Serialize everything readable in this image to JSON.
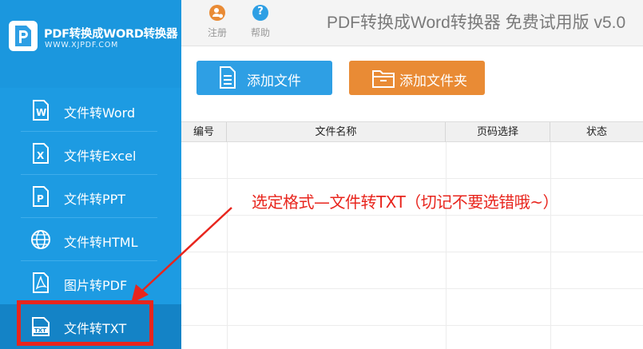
{
  "brand": {
    "title": "PDF转换成WORD转换器",
    "subtitle": "WWW.XJPDF.COM"
  },
  "sidebar": {
    "items": [
      {
        "label": "文件转Word",
        "icon": "word-icon"
      },
      {
        "label": "文件转Excel",
        "icon": "excel-icon"
      },
      {
        "label": "文件转PPT",
        "icon": "ppt-icon"
      },
      {
        "label": "文件转HTML",
        "icon": "globe-icon"
      },
      {
        "label": "图片转PDF",
        "icon": "pdf-icon"
      },
      {
        "label": "文件转TXT",
        "icon": "txt-icon"
      }
    ],
    "active_index": 5
  },
  "toolbar": {
    "register_label": "注册",
    "help_label": "帮助",
    "help_glyph": "?",
    "app_title": "PDF转换成Word转换器 免费试用版 v5.0"
  },
  "actions": {
    "add_file_label": "添加文件",
    "add_folder_label": "添加文件夹"
  },
  "table": {
    "columns": [
      "编号",
      "文件名称",
      "页码选择",
      "状态"
    ],
    "rows": []
  },
  "annotation": {
    "text": "选定格式—文件转TXT（切记不要选错哦~）"
  },
  "colors": {
    "sidebar": "#1d9be2",
    "sidebar_active": "#1483c6",
    "highlight": "#e8251d",
    "add_file_button": "#2e9fe4",
    "add_folder_button": "#e98b35"
  }
}
